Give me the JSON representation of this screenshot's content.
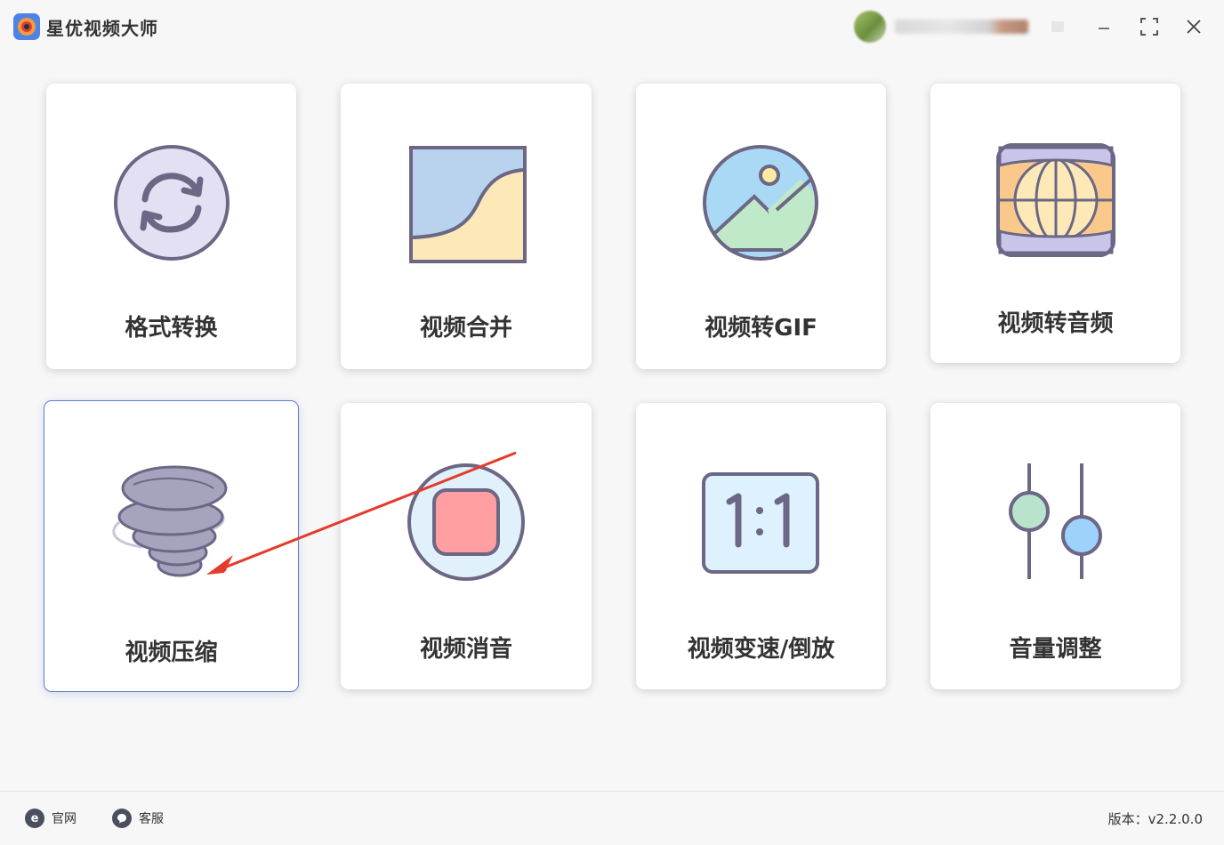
{
  "app": {
    "title": "星优视频大师"
  },
  "window_controls": [
    "menu",
    "minimize",
    "maximize",
    "close"
  ],
  "tools": [
    {
      "label": "格式转换",
      "icon": "convert-icon"
    },
    {
      "label": "视频合并",
      "icon": "merge-icon"
    },
    {
      "label": "视频转GIF",
      "icon": "image-gif-icon"
    },
    {
      "label": "视频转音频",
      "icon": "audio-icon"
    },
    {
      "label": "视频压缩",
      "icon": "tornado-compress-icon",
      "selected": true
    },
    {
      "label": "视频消音",
      "icon": "stop-mute-icon"
    },
    {
      "label": "视频变速/倒放",
      "icon": "ratio-speed-icon"
    },
    {
      "label": "音量调整",
      "icon": "slider-volume-icon"
    }
  ],
  "footer": {
    "website": "官网",
    "support": "客服",
    "version": "版本：v2.2.0.0"
  },
  "colors": {
    "icon_stroke": "#6b6785",
    "annotation_arrow": "#e53b2c",
    "selected_border": "#5b7fd6"
  }
}
